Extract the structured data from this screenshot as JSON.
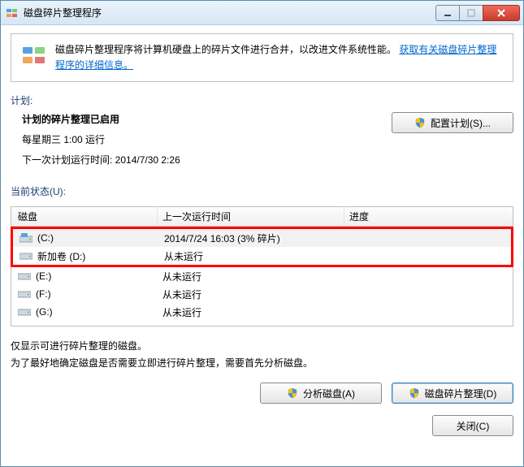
{
  "window": {
    "title": "磁盘碎片整理程序"
  },
  "info": {
    "text_prefix": "磁盘碎片整理程序将计算机硬盘上的碎片文件进行合并，以改进文件系统性能。",
    "link_text": "获取有关磁盘碎片整理程序的详细信息。"
  },
  "schedule": {
    "section_label": "计划:",
    "enabled_text": "计划的碎片整理已启用",
    "recurrence": "每星期三  1:00 运行",
    "next_run": "下一次计划运行时间: 2014/7/30 2:26",
    "configure_btn": "配置计划(S)..."
  },
  "status": {
    "section_label": "当前状态(U):",
    "columns": {
      "disk": "磁盘",
      "last_run": "上一次运行时间",
      "progress": "进度"
    },
    "rows": [
      {
        "name": "(C:)",
        "last_run": "2014/7/24 16:03 (3% 碎片)",
        "highlighted": true,
        "selected": true,
        "icon": "system"
      },
      {
        "name": "新加卷 (D:)",
        "last_run": "从未运行",
        "highlighted": true,
        "selected": false,
        "icon": "drive"
      },
      {
        "name": "(E:)",
        "last_run": "从未运行",
        "highlighted": false,
        "selected": false,
        "icon": "drive"
      },
      {
        "name": "(F:)",
        "last_run": "从未运行",
        "highlighted": false,
        "selected": false,
        "icon": "drive"
      },
      {
        "name": "(G:)",
        "last_run": "从未运行",
        "highlighted": false,
        "selected": false,
        "icon": "drive"
      }
    ]
  },
  "hint": {
    "line1": "仅显示可进行碎片整理的磁盘。",
    "line2": "为了最好地确定磁盘是否需要立即进行碎片整理，需要首先分析磁盘。"
  },
  "buttons": {
    "analyze": "分析磁盘(A)",
    "defrag": "磁盘碎片整理(D)",
    "close": "关闭(C)"
  }
}
